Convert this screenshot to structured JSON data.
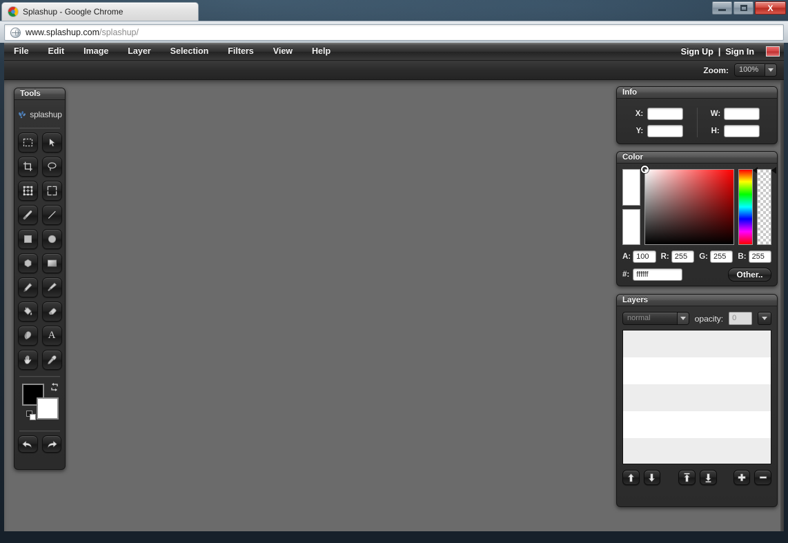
{
  "window": {
    "tab_title": "Splashup - Google Chrome",
    "minimize_label": "Minimize",
    "maximize_label": "Maximize",
    "close_label": "X"
  },
  "browser": {
    "url_main": "www.splashup.com",
    "url_path": "/splashup/",
    "globe_icon": "globe-icon"
  },
  "menubar": {
    "items": [
      {
        "label": "File"
      },
      {
        "label": "Edit"
      },
      {
        "label": "Image"
      },
      {
        "label": "Layer"
      },
      {
        "label": "Selection"
      },
      {
        "label": "Filters"
      },
      {
        "label": "View"
      },
      {
        "label": "Help"
      }
    ],
    "sign_up": "Sign Up",
    "separator": "|",
    "sign_in": "Sign In",
    "flag_icon": "flag-icon",
    "flag_color": "#d64848"
  },
  "toolbar": {
    "zoom_label": "Zoom:",
    "zoom_value": "100%",
    "zoom_caret": "chevron-down-icon"
  },
  "tools": {
    "title": "Tools",
    "brand": "splashup",
    "items": [
      {
        "name": "rectangular-marquee-tool",
        "icon": "dashed-rectangle-icon"
      },
      {
        "name": "move-tool",
        "icon": "cursor-arrow-icon"
      },
      {
        "name": "crop-tool",
        "icon": "crop-icon"
      },
      {
        "name": "lasso-tool",
        "icon": "lasso-icon"
      },
      {
        "name": "transform-tool",
        "icon": "transform-handles-icon"
      },
      {
        "name": "free-transform-tool",
        "icon": "rotate-arrows-icon"
      },
      {
        "name": "line-thick-tool",
        "icon": "thick-line-icon"
      },
      {
        "name": "line-thin-tool",
        "icon": "thin-line-icon"
      },
      {
        "name": "rectangle-shape-tool",
        "icon": "filled-square-icon"
      },
      {
        "name": "ellipse-shape-tool",
        "icon": "filled-circle-icon"
      },
      {
        "name": "polygon-shape-tool",
        "icon": "hexagon-icon"
      },
      {
        "name": "gradient-tool",
        "icon": "gradient-square-icon"
      },
      {
        "name": "pencil-tool",
        "icon": "pencil-icon"
      },
      {
        "name": "brush-tool",
        "icon": "paintbrush-icon"
      },
      {
        "name": "paint-bucket-tool",
        "icon": "paint-bucket-icon"
      },
      {
        "name": "eraser-tool",
        "icon": "eraser-icon"
      },
      {
        "name": "smudge-tool",
        "icon": "smudge-finger-icon"
      },
      {
        "name": "text-tool",
        "icon": "letter-a-icon"
      },
      {
        "name": "hand-tool",
        "icon": "hand-icon"
      },
      {
        "name": "eyedropper-tool",
        "icon": "eyedropper-icon"
      }
    ],
    "foreground_color": "#000000",
    "background_color": "#ffffff",
    "swap_icon": "swap-colors-icon",
    "default_colors_icon": "default-colors-icon",
    "undo_icon": "undo-arrow-icon",
    "redo_icon": "redo-arrow-icon"
  },
  "info": {
    "title": "Info",
    "fields": [
      {
        "label": "X:",
        "value": ""
      },
      {
        "label": "Y:",
        "value": ""
      },
      {
        "label": "W:",
        "value": ""
      },
      {
        "label": "H:",
        "value": ""
      }
    ]
  },
  "color": {
    "title": "Color",
    "primary_swatch": "#ffffff",
    "secondary_swatch": "#ffffff",
    "hue_base": "#ff0000",
    "inputs": [
      {
        "label": "A:",
        "value": "100"
      },
      {
        "label": "R:",
        "value": "255"
      },
      {
        "label": "G:",
        "value": "255"
      },
      {
        "label": "B:",
        "value": "255"
      }
    ],
    "hex_label": "#:",
    "hex_value": "ffffff",
    "other_button": "Other..",
    "sv_cursor": "color-picker-cursor",
    "hue_marker": "hue-slider-marker",
    "alpha_marker": "alpha-slider-marker"
  },
  "layers": {
    "title": "Layers",
    "blend_mode": "normal",
    "blend_caret": "chevron-down-icon",
    "opacity_label": "opacity:",
    "opacity_value": "0",
    "opacity_caret": "chevron-down-icon",
    "rows": [
      {
        "shade": "alt"
      },
      {
        "shade": "plain"
      },
      {
        "shade": "alt"
      },
      {
        "shade": "plain"
      },
      {
        "shade": "alt"
      },
      {
        "shade": "plain"
      }
    ],
    "buttons": [
      {
        "name": "move-layer-up-button",
        "icon": "arrow-up-icon"
      },
      {
        "name": "move-layer-down-button",
        "icon": "arrow-down-icon"
      },
      {
        "name": "move-layer-to-top-button",
        "icon": "arrow-to-top-icon"
      },
      {
        "name": "move-layer-to-bottom-button",
        "icon": "arrow-to-bottom-icon"
      },
      {
        "name": "add-layer-button",
        "icon": "plus-icon"
      },
      {
        "name": "delete-layer-button",
        "icon": "minus-icon"
      }
    ]
  },
  "canvas": {
    "background_color": "#6b6b6b"
  }
}
